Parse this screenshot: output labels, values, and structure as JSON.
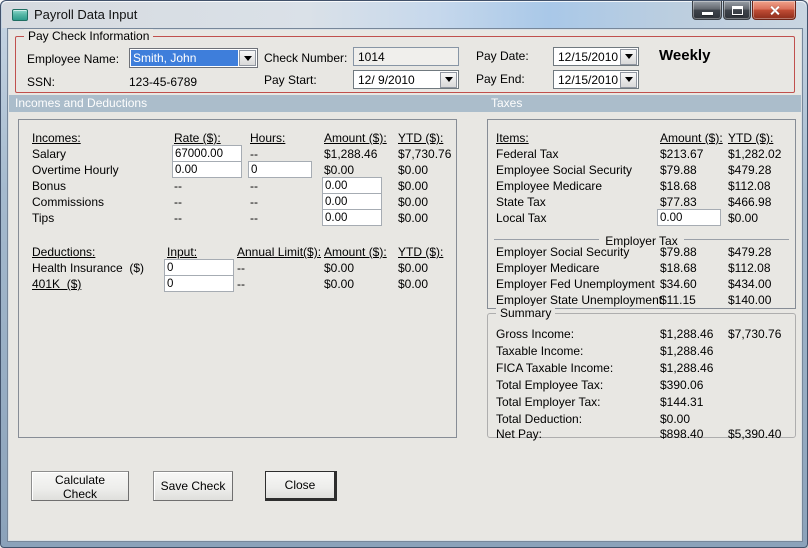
{
  "window": {
    "title": "Payroll Data Input"
  },
  "colors": {
    "band": "#ABBDCB",
    "paycheck_border": "#C0504D",
    "selection_blue": "#3E7EDB",
    "close_button_red": "#C14D35",
    "client_background": "#E8E7E3"
  },
  "paycheck": {
    "legend": "Pay Check Information",
    "employee_name_label": "Employee Name:",
    "employee_name_value": "Smith, John",
    "ssn_label": "SSN:",
    "ssn_value": "123-45-6789",
    "check_number_label": "Check Number:",
    "check_number_value": "1014",
    "pay_start_label": "Pay Start:",
    "pay_start_value": "12/ 9/2010",
    "pay_date_label": "Pay Date:",
    "pay_date_value": "12/15/2010",
    "pay_end_label": "Pay End:",
    "pay_end_value": "12/15/2010",
    "frequency": "Weekly"
  },
  "sections": {
    "incomes_band": "Incomes and Deductions",
    "taxes_band": "Taxes"
  },
  "incomes": {
    "headers": {
      "name": "Incomes:",
      "rate": "Rate ($):",
      "hours": "Hours:",
      "amount": "Amount ($):",
      "ytd": "YTD ($):"
    },
    "rows": [
      {
        "label": "Salary",
        "rate": "67000.00",
        "hours": "--",
        "amount": "$1,288.46",
        "ytd": "$7,730.76"
      },
      {
        "label": "Overtime Hourly",
        "rate": "0.00",
        "hours": "0",
        "amount": "$0.00",
        "ytd": "$0.00"
      },
      {
        "label": "Bonus",
        "rate": "--",
        "hours": "--",
        "amount": "0.00",
        "ytd": "$0.00"
      },
      {
        "label": "Commissions",
        "rate": "--",
        "hours": "--",
        "amount": "0.00",
        "ytd": "$0.00"
      },
      {
        "label": "Tips",
        "rate": "--",
        "hours": "--",
        "amount": "0.00",
        "ytd": "$0.00"
      }
    ]
  },
  "deductions": {
    "headers": {
      "name": "Deductions:",
      "input": "Input:",
      "limit": "Annual Limit($):",
      "amount": "Amount ($):",
      "ytd": "YTD ($):"
    },
    "rows": [
      {
        "label": "Health Insurance  ($)",
        "input": "0",
        "limit": "--",
        "amount": "$0.00",
        "ytd": "$0.00"
      },
      {
        "label": "401K  ($)",
        "input": "0",
        "limit": "--",
        "amount": "$0.00",
        "ytd": "$0.00"
      }
    ]
  },
  "taxes": {
    "headers": {
      "items": "Items:",
      "amount": "Amount ($):",
      "ytd": "YTD ($):"
    },
    "employee_rows": [
      {
        "label": "Federal Tax",
        "amount": "$213.67",
        "ytd": "$1,282.02"
      },
      {
        "label": "Employee Social Security",
        "amount": "$79.88",
        "ytd": "$479.28"
      },
      {
        "label": "Employee Medicare",
        "amount": "$18.68",
        "ytd": "$112.08"
      },
      {
        "label": "State Tax",
        "amount": "$77.83",
        "ytd": "$466.98"
      },
      {
        "label": "Local Tax",
        "amount": "0.00",
        "ytd": "$0.00"
      }
    ],
    "employer_group_label": "Employer Tax",
    "employer_rows": [
      {
        "label": "Employer Social Security",
        "amount": "$79.88",
        "ytd": "$479.28"
      },
      {
        "label": "Employer Medicare",
        "amount": "$18.68",
        "ytd": "$112.08"
      },
      {
        "label": "Employer Fed Unemployment",
        "amount": "$34.60",
        "ytd": "$434.00"
      },
      {
        "label": "Employer State Unemployment",
        "amount": "$11.15",
        "ytd": "$140.00"
      }
    ]
  },
  "summary": {
    "legend": "Summary",
    "rows": [
      {
        "label": "Gross Income:",
        "amount": "$1,288.46",
        "ytd": "$7,730.76"
      },
      {
        "label": "Taxable Income:",
        "amount": "$1,288.46",
        "ytd": ""
      },
      {
        "label": "FICA Taxable Income:",
        "amount": "$1,288.46",
        "ytd": ""
      },
      {
        "label": "Total Employee Tax:",
        "amount": "$390.06",
        "ytd": ""
      },
      {
        "label": "Total Employer Tax:",
        "amount": "$144.31",
        "ytd": ""
      },
      {
        "label": "Total Deduction:",
        "amount": "$0.00",
        "ytd": ""
      },
      {
        "label": "Net Pay:",
        "amount": "$898.40",
        "ytd": "$5,390.40"
      }
    ]
  },
  "buttons": {
    "calculate": "Calculate Check",
    "save": "Save Check",
    "close": "Close"
  }
}
